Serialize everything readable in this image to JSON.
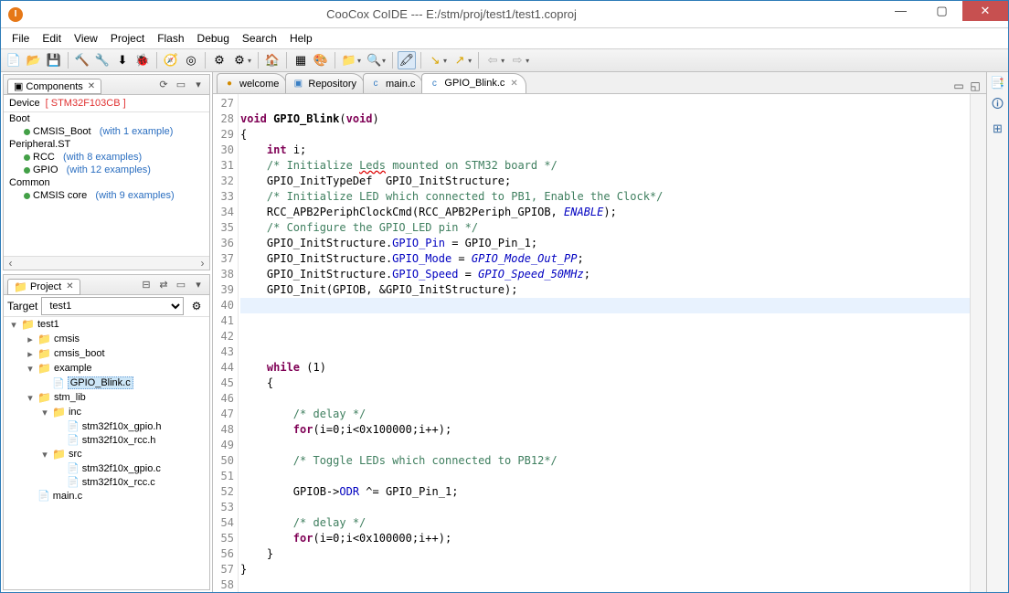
{
  "title": "CooCox CoIDE --- E:/stm/proj/test1/test1.coproj",
  "win": {
    "min": "—",
    "max": "▢",
    "close": "✕"
  },
  "menu": [
    "File",
    "Edit",
    "View",
    "Project",
    "Flash",
    "Debug",
    "Search",
    "Help"
  ],
  "panels": {
    "components": {
      "title": "Components",
      "deviceLabel": "Device",
      "deviceName": "[ STM32F103CB ]",
      "groups": [
        {
          "label": "Boot",
          "items": [
            {
              "name": "CMSIS_Boot",
              "ex": "(with 1 example)"
            }
          ]
        },
        {
          "label": "Peripheral.ST",
          "items": [
            {
              "name": "RCC",
              "ex": "(with 8 examples)"
            },
            {
              "name": "GPIO",
              "ex": "(with 12 examples)"
            }
          ]
        },
        {
          "label": "Common",
          "items": [
            {
              "name": "CMSIS core",
              "ex": "(with 9 examples)"
            }
          ]
        }
      ]
    },
    "project": {
      "title": "Project",
      "targetLabel": "Target",
      "targetValue": "test1",
      "tree": {
        "root": "test1",
        "nodes": [
          {
            "t": "folder",
            "d": 1,
            "label": "cmsis"
          },
          {
            "t": "folder",
            "d": 1,
            "label": "cmsis_boot"
          },
          {
            "t": "folder",
            "d": 1,
            "label": "example",
            "open": true
          },
          {
            "t": "cfile",
            "d": 2,
            "label": "GPIO_Blink.c",
            "sel": true
          },
          {
            "t": "folder",
            "d": 1,
            "label": "stm_lib",
            "open": true
          },
          {
            "t": "folder",
            "d": 2,
            "label": "inc",
            "open": true
          },
          {
            "t": "hfile",
            "d": 3,
            "label": "stm32f10x_gpio.h"
          },
          {
            "t": "hfile",
            "d": 3,
            "label": "stm32f10x_rcc.h"
          },
          {
            "t": "folder",
            "d": 2,
            "label": "src",
            "open": true
          },
          {
            "t": "cfile",
            "d": 3,
            "label": "stm32f10x_gpio.c"
          },
          {
            "t": "cfile",
            "d": 3,
            "label": "stm32f10x_rcc.c"
          },
          {
            "t": "hfile",
            "d": 1,
            "label": "main.c"
          }
        ]
      }
    }
  },
  "tabs": [
    {
      "label": "welcome",
      "icon": "●",
      "color": "#d28a00"
    },
    {
      "label": "Repository",
      "icon": "▣",
      "color": "#3a7fc4"
    },
    {
      "label": "main.c",
      "icon": "c",
      "color": "#3a7fc4"
    },
    {
      "label": "GPIO_Blink.c",
      "icon": "c",
      "color": "#3a7fc4",
      "active": true
    }
  ],
  "code": {
    "start": 27,
    "lines": [
      {
        "n": 27,
        "h": ""
      },
      {
        "n": 28,
        "h": "<span class='kw'>void</span> <b>GPIO_Blink</b>(<span class='kw'>void</span>)"
      },
      {
        "n": 29,
        "h": "{"
      },
      {
        "n": 30,
        "h": "    <span class='kw'>int</span> i;"
      },
      {
        "n": 31,
        "h": "    <span class='cm'>/* Initialize <u style='text-decoration:wavy underline #d00'>Leds</u> mounted on STM32 board */</span>"
      },
      {
        "n": 32,
        "h": "    GPIO_InitTypeDef  GPIO_InitStructure;"
      },
      {
        "n": 33,
        "h": "    <span class='cm'>/* Initialize LED which connected to PB1, Enable the Clock*/</span>"
      },
      {
        "n": 34,
        "h": "    RCC_APB2PeriphClockCmd(RCC_APB2Periph_GPIOB, <span class='sp'>ENABLE</span>);"
      },
      {
        "n": 35,
        "h": "    <span class='cm'>/* Configure the GPIO_LED pin */</span>"
      },
      {
        "n": 36,
        "h": "    GPIO_InitStructure.<span class='nm'>GPIO_Pin</span> = GPIO_Pin_1;"
      },
      {
        "n": 37,
        "h": "    GPIO_InitStructure.<span class='nm'>GPIO_Mode</span> = <span class='sp'>GPIO_Mode_Out_PP</span>;"
      },
      {
        "n": 38,
        "h": "    GPIO_InitStructure.<span class='nm'>GPIO_Speed</span> = <span class='sp'>GPIO_Speed_50MHz</span>;"
      },
      {
        "n": 39,
        "h": "    GPIO_Init(GPIOB, &amp;GPIO_InitStructure);"
      },
      {
        "n": 40,
        "h": "",
        "hl": true
      },
      {
        "n": 41,
        "h": ""
      },
      {
        "n": 42,
        "h": ""
      },
      {
        "n": 43,
        "h": ""
      },
      {
        "n": 44,
        "h": "    <span class='kw'>while</span> (1)"
      },
      {
        "n": 45,
        "h": "    {"
      },
      {
        "n": 46,
        "h": ""
      },
      {
        "n": 47,
        "h": "        <span class='cm'>/* delay */</span>"
      },
      {
        "n": 48,
        "h": "        <span class='kw'>for</span>(i=0;i&lt;0x100000;i++);"
      },
      {
        "n": 49,
        "h": ""
      },
      {
        "n": 50,
        "h": "        <span class='cm'>/* Toggle LEDs which connected to PB12*/</span>"
      },
      {
        "n": 51,
        "h": ""
      },
      {
        "n": 52,
        "h": "        GPIOB-&gt;<span class='nm'>ODR</span> ^= GPIO_Pin_1;"
      },
      {
        "n": 53,
        "h": ""
      },
      {
        "n": 54,
        "h": "        <span class='cm'>/* delay */</span>"
      },
      {
        "n": 55,
        "h": "        <span class='kw'>for</span>(i=0;i&lt;0x100000;i++);"
      },
      {
        "n": 56,
        "h": "    }"
      },
      {
        "n": 57,
        "h": "}"
      },
      {
        "n": 58,
        "h": ""
      }
    ]
  }
}
